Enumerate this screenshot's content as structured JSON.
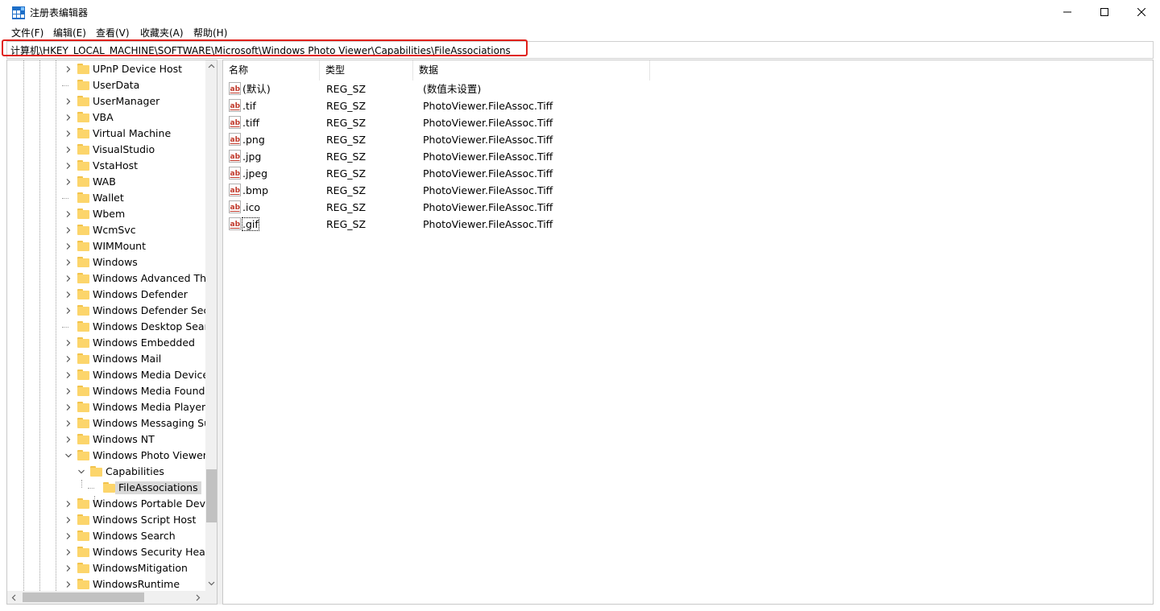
{
  "window": {
    "title": "注册表编辑器",
    "minimize_icon": "minimize-icon",
    "maximize_icon": "maximize-icon",
    "close_icon": "close-icon"
  },
  "menu": [
    "文件(F)",
    "编辑(E)",
    "查看(V)",
    "收藏夹(A)",
    "帮助(H)"
  ],
  "address": {
    "path": "计算机\\HKEY_LOCAL_MACHINE\\SOFTWARE\\Microsoft\\Windows Photo Viewer\\Capabilities\\FileAssociations",
    "highlight_color": "#e0201a"
  },
  "tree": [
    {
      "label": "UPnP Device Host",
      "expander": "collapsed"
    },
    {
      "label": "UserData",
      "expander": "none"
    },
    {
      "label": "UserManager",
      "expander": "collapsed"
    },
    {
      "label": "VBA",
      "expander": "collapsed"
    },
    {
      "label": "Virtual Machine",
      "expander": "collapsed"
    },
    {
      "label": "VisualStudio",
      "expander": "collapsed"
    },
    {
      "label": "VstaHost",
      "expander": "collapsed"
    },
    {
      "label": "WAB",
      "expander": "collapsed"
    },
    {
      "label": "Wallet",
      "expander": "none"
    },
    {
      "label": "Wbem",
      "expander": "collapsed"
    },
    {
      "label": "WcmSvc",
      "expander": "collapsed"
    },
    {
      "label": "WIMMount",
      "expander": "collapsed"
    },
    {
      "label": "Windows",
      "expander": "collapsed"
    },
    {
      "label": "Windows Advanced Thre",
      "expander": "collapsed"
    },
    {
      "label": "Windows Defender",
      "expander": "collapsed"
    },
    {
      "label": "Windows Defender Secu",
      "expander": "collapsed"
    },
    {
      "label": "Windows Desktop Searc",
      "expander": "none"
    },
    {
      "label": "Windows Embedded",
      "expander": "collapsed"
    },
    {
      "label": "Windows Mail",
      "expander": "collapsed"
    },
    {
      "label": "Windows Media Device",
      "expander": "collapsed"
    },
    {
      "label": "Windows Media Founda",
      "expander": "collapsed"
    },
    {
      "label": "Windows Media Player I",
      "expander": "collapsed"
    },
    {
      "label": "Windows Messaging Su",
      "expander": "collapsed"
    },
    {
      "label": "Windows NT",
      "expander": "collapsed"
    },
    {
      "label": "Windows Photo Viewer",
      "expander": "expanded"
    },
    {
      "label": "Capabilities",
      "expander": "expanded"
    },
    {
      "label": "FileAssociations",
      "expander": "none",
      "selected": true
    },
    {
      "label": "Windows Portable Devic",
      "expander": "collapsed"
    },
    {
      "label": "Windows Script Host",
      "expander": "collapsed"
    },
    {
      "label": "Windows Search",
      "expander": "collapsed"
    },
    {
      "label": "Windows Security Health",
      "expander": "collapsed"
    },
    {
      "label": "WindowsMitigation",
      "expander": "collapsed"
    },
    {
      "label": "WindowsRuntime",
      "expander": "collapsed"
    }
  ],
  "columns": {
    "name": "名称",
    "type": "类型",
    "data": "数据"
  },
  "values": [
    {
      "name": "(默认)",
      "type": "REG_SZ",
      "data": "(数值未设置)"
    },
    {
      "name": ".tif",
      "type": "REG_SZ",
      "data": "PhotoViewer.FileAssoc.Tiff"
    },
    {
      "name": ".tiff",
      "type": "REG_SZ",
      "data": "PhotoViewer.FileAssoc.Tiff"
    },
    {
      "name": ".png",
      "type": "REG_SZ",
      "data": "PhotoViewer.FileAssoc.Tiff"
    },
    {
      "name": ".jpg",
      "type": "REG_SZ",
      "data": "PhotoViewer.FileAssoc.Tiff"
    },
    {
      "name": ".jpeg",
      "type": "REG_SZ",
      "data": "PhotoViewer.FileAssoc.Tiff"
    },
    {
      "name": ".bmp",
      "type": "REG_SZ",
      "data": "PhotoViewer.FileAssoc.Tiff"
    },
    {
      "name": ".ico",
      "type": "REG_SZ",
      "data": "PhotoViewer.FileAssoc.Tiff"
    },
    {
      "name": ".gif",
      "type": "REG_SZ",
      "data": "PhotoViewer.FileAssoc.Tiff",
      "focused": true
    }
  ]
}
